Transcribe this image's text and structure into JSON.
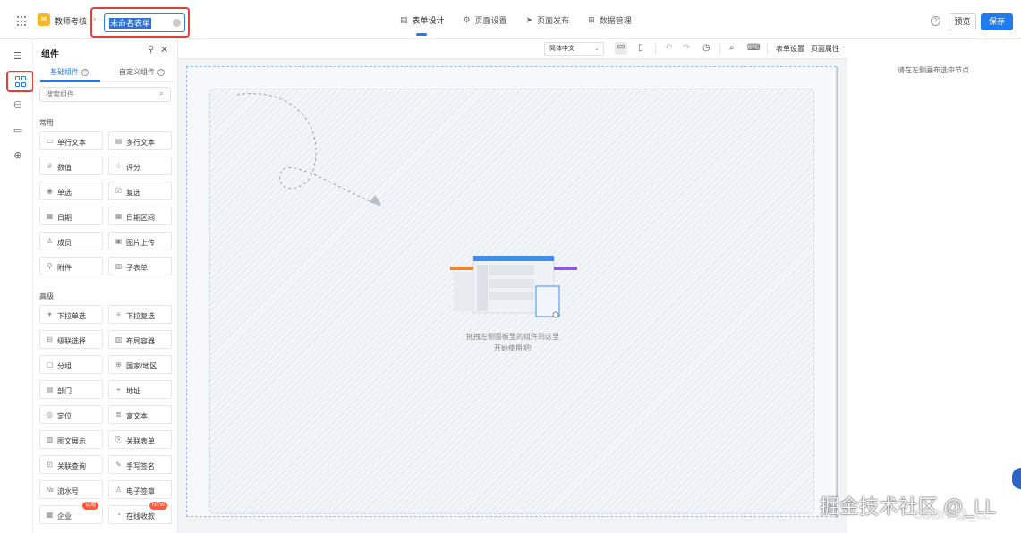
{
  "header": {
    "app_name": "教师考核",
    "form_title": "未命名表单",
    "nav": [
      {
        "label": "表单设计",
        "icon": "document-icon",
        "active": true
      },
      {
        "label": "页面设置",
        "icon": "gear-icon",
        "active": false
      },
      {
        "label": "页面发布",
        "icon": "send-icon",
        "active": false
      },
      {
        "label": "数据管理",
        "icon": "table-icon",
        "active": false
      }
    ],
    "preview_label": "预览",
    "save_label": "保存",
    "accent_color": "#1f7bf0",
    "highlight_color": "#e0403a"
  },
  "panel": {
    "title": "组件",
    "tabs": [
      "基础组件",
      "自定义组件"
    ],
    "search_placeholder": "搜索组件",
    "group_common": "常用",
    "group_advanced": "高级",
    "common": [
      {
        "label": "单行文本",
        "icon": "input-icon"
      },
      {
        "label": "多行文本",
        "icon": "textarea-icon"
      },
      {
        "label": "数值",
        "icon": "number-icon"
      },
      {
        "label": "评分",
        "icon": "star-icon"
      },
      {
        "label": "单选",
        "icon": "radio-icon"
      },
      {
        "label": "复选",
        "icon": "checkbox-icon"
      },
      {
        "label": "日期",
        "icon": "calendar-icon"
      },
      {
        "label": "日期区间",
        "icon": "date-range-icon"
      },
      {
        "label": "成员",
        "icon": "member-icon"
      },
      {
        "label": "图片上传",
        "icon": "image-icon"
      },
      {
        "label": "附件",
        "icon": "attachment-icon"
      },
      {
        "label": "子表单",
        "icon": "subform-icon"
      }
    ],
    "advanced": [
      {
        "label": "下拉单选",
        "icon": "dropdown-icon"
      },
      {
        "label": "下拉复选",
        "icon": "dropdown-multi-icon"
      },
      {
        "label": "级联选择",
        "icon": "cascade-icon"
      },
      {
        "label": "布局容器",
        "icon": "layout-icon"
      },
      {
        "label": "分组",
        "icon": "group-icon"
      },
      {
        "label": "国家/地区",
        "icon": "globe-icon"
      },
      {
        "label": "部门",
        "icon": "department-icon"
      },
      {
        "label": "地址",
        "icon": "address-icon"
      },
      {
        "label": "定位",
        "icon": "location-icon"
      },
      {
        "label": "富文本",
        "icon": "richtext-icon"
      },
      {
        "label": "图文展示",
        "icon": "image-text-icon"
      },
      {
        "label": "关联表单",
        "icon": "link-form-icon"
      },
      {
        "label": "关联查询",
        "icon": "query-icon"
      },
      {
        "label": "手写签名",
        "icon": "signature-icon"
      },
      {
        "label": "流水号",
        "icon": "serial-icon"
      },
      {
        "label": "电子签章",
        "icon": "seal-icon"
      },
      {
        "label": "企业",
        "icon": "company-icon",
        "badge": "试用"
      },
      {
        "label": "在线收款",
        "icon": "payment-icon",
        "badge": "NEW"
      }
    ]
  },
  "toolbar": {
    "language": "简体中文",
    "form_settings": "表单设置",
    "page_props": "页面属性"
  },
  "canvas": {
    "hint_line1": "拖拽左侧面板里的组件到这里",
    "hint_line2": "开始使用吧!"
  },
  "right_panel": {
    "hint": "请在左侧画布选中节点"
  },
  "watermark": {
    "line1": "掘金技术社区 @_LL",
    "line2": "CSDN @_LL"
  }
}
